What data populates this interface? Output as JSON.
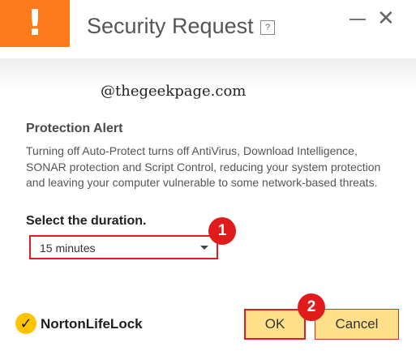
{
  "window": {
    "title": "Security Request",
    "help": "?",
    "close": "✕"
  },
  "watermark": "@thegeekpage.com",
  "alert": {
    "title": "Protection Alert",
    "body": "Turning off Auto-Protect turns off AntiVirus, Download Intelligence, SONAR protection and Script Control, reducing your system protection and leaving your computer vulnerable to some network-based threats."
  },
  "duration": {
    "label": "Select the duration.",
    "selected": "15 minutes"
  },
  "badges": [
    "1",
    "2"
  ],
  "buttons": {
    "ok": "OK",
    "cancel": "Cancel"
  },
  "brand": {
    "name": "NortonLifeLock",
    "accent": "#ff7a1a",
    "button_fill": "#ffe08a",
    "highlight": "#e21b23"
  }
}
